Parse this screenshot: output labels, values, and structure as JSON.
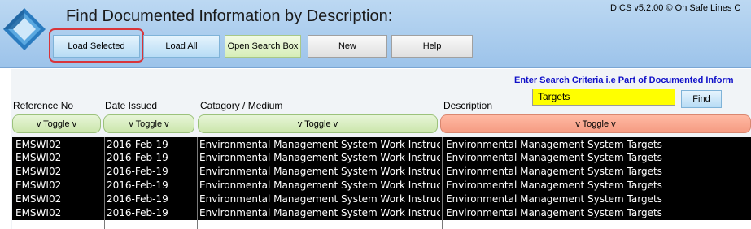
{
  "app": {
    "title": "Find Documented Information by Description:",
    "version": "DICS v5.2.00 © On Safe Lines C"
  },
  "toolbar": {
    "load_selected": "Load Selected",
    "load_all": "Load All",
    "open_search_box": "Open Search Box",
    "new": "New",
    "help": "Help"
  },
  "search": {
    "criteria_label": "Enter Search Criteria i.e Part of Documented Inform",
    "value": "Targets",
    "find_label": "Find"
  },
  "columns": {
    "reference_no": "Reference No",
    "date_issued": "Date Issued",
    "category_medium": "Catagory / Medium",
    "description": "Description"
  },
  "toggles": {
    "reference_no": "v Toggle v",
    "date_issued": "v Toggle v",
    "category_medium": "v Toggle v",
    "description": "v Toggle v"
  },
  "rows": [
    {
      "ref": "EMSWI02",
      "date": "2016-Feb-19",
      "category": "Environmental Management System Work Instructio",
      "description": "Environmental Management System Targets"
    },
    {
      "ref": "EMSWI02",
      "date": "2016-Feb-19",
      "category": "Environmental Management System Work Instructio",
      "description": "Environmental Management System Targets"
    },
    {
      "ref": "EMSWI02",
      "date": "2016-Feb-19",
      "category": "Environmental Management System Work Instructio",
      "description": "Environmental Management System Targets"
    },
    {
      "ref": "EMSWI02",
      "date": "2016-Feb-19",
      "category": "Environmental Management System Work Instructio",
      "description": "Environmental Management System Targets"
    },
    {
      "ref": "EMSWI02",
      "date": "2016-Feb-19",
      "category": "Environmental Management System Work Instructio",
      "description": "Environmental Management System Targets"
    },
    {
      "ref": "EMSWI02",
      "date": "2016-Feb-19",
      "category": "Environmental Management System Work Instructio",
      "description": "Environmental Management System Targets"
    }
  ],
  "colors": {
    "header_bg": "#9cc3ea",
    "search_highlight": "#ffff00",
    "criteria_text": "#1010c8",
    "selected_ring": "#d8343a",
    "grid_bg": "#000000",
    "description_toggle": "#f59b82"
  },
  "icons": {
    "logo": "diamond-logo-icon"
  }
}
